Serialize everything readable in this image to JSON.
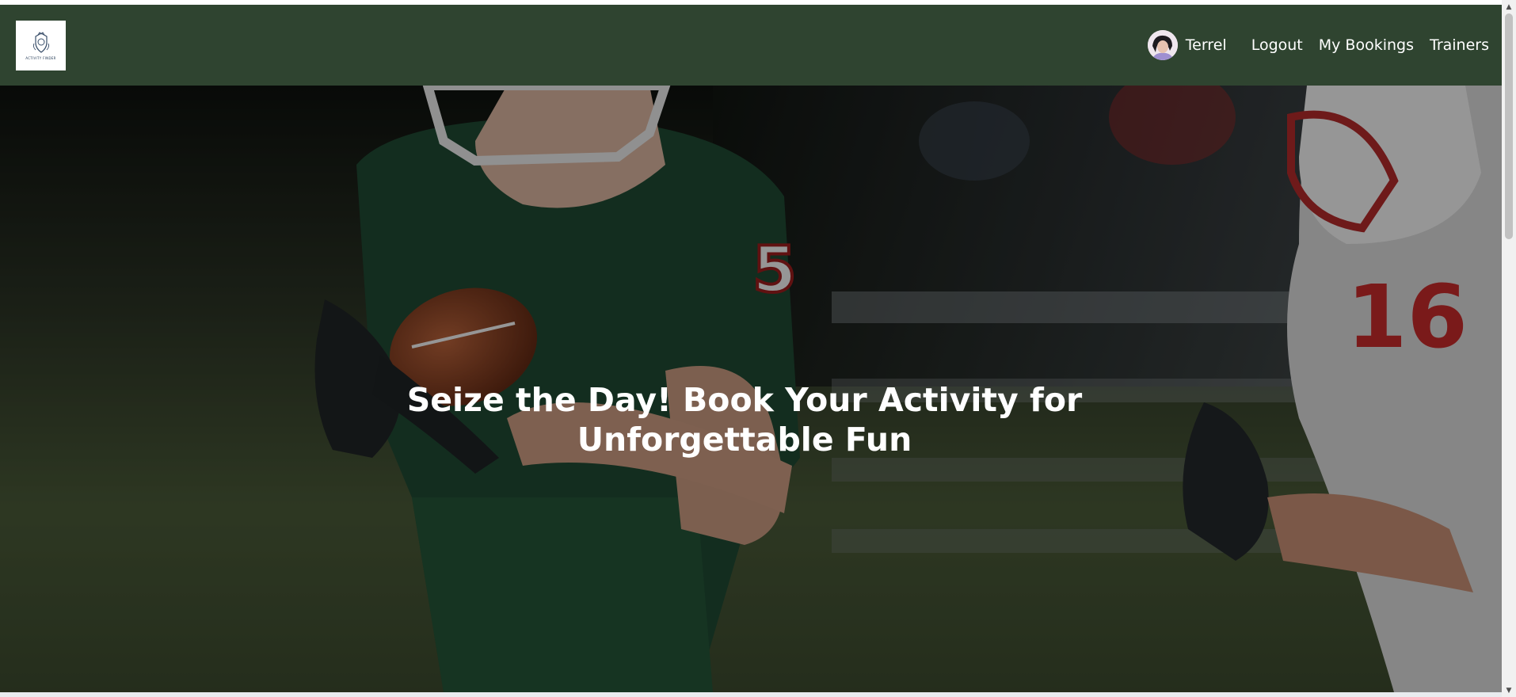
{
  "navbar": {
    "logo_text": "ACTIVITY FINDER",
    "user_name": "Terrel",
    "links": {
      "logout": "Logout",
      "my_bookings": "My Bookings",
      "trainers": "Trainers"
    },
    "background_color": "#2f4430"
  },
  "hero": {
    "heading": "Seize the Day! Book Your Activity for Unforgettable Fun",
    "jersey_numbers": [
      "5",
      "16"
    ]
  },
  "icons": {
    "logo": "crest-logo-icon",
    "avatar": "user-avatar",
    "scroll_up": "up-arrow-icon",
    "scroll_down": "down-arrow-icon"
  }
}
